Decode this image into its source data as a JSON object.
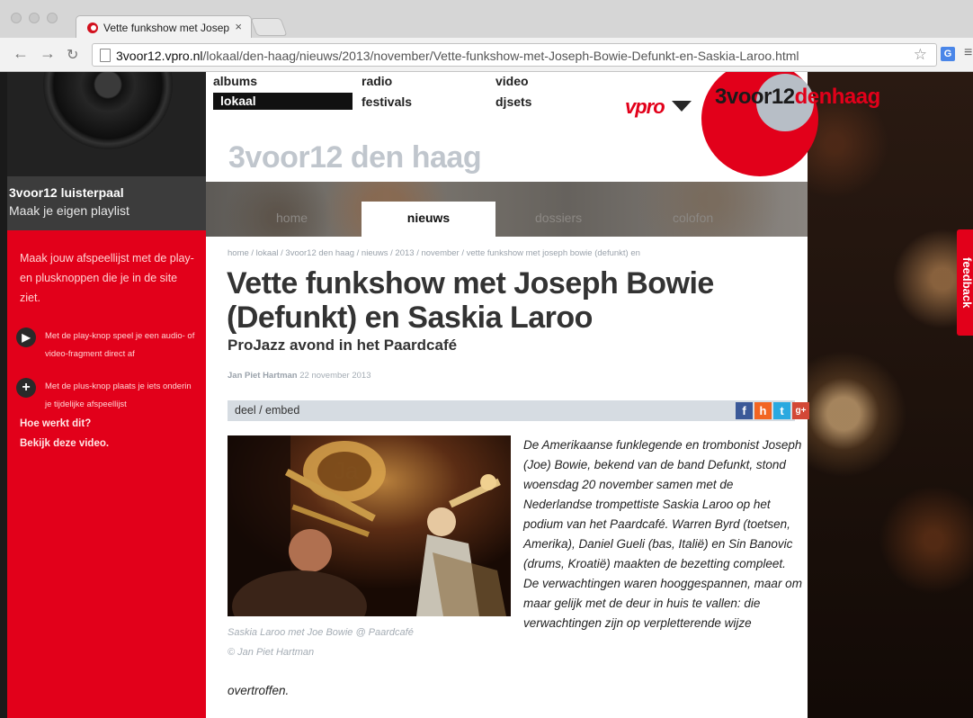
{
  "browser": {
    "tab_title": "Vette funkshow met Joseph",
    "tab_close": "×",
    "url_host": "3voor12.vpro.nl",
    "url_path": "/lokaal/den-haag/nieuws/2013/november/Vette-funkshow-met-Joseph-Bowie-Defunkt-en-Saskia-Laroo.html",
    "icons": [
      "back-icon",
      "forward-icon",
      "reload-icon",
      "star-icon",
      "translate-icon",
      "menu-icon"
    ]
  },
  "topnav": {
    "albums": "albums",
    "lokaal": "lokaal",
    "radio": "radio",
    "festivals": "festivals",
    "video": "video",
    "djsets": "djsets"
  },
  "logo": {
    "vpro": "vpro",
    "brand": "3voor12",
    "city": "denhaag"
  },
  "site_title": "3voor12 den haag",
  "subnav": {
    "home": "home",
    "nieuws": "nieuws",
    "dossiers": "dossiers",
    "colofon": "colofon"
  },
  "sidebar": {
    "title": "3voor12 luisterpaal",
    "subtitle": "Maak je eigen playlist",
    "intro": "Maak jouw afspeellijst met de play- en plusknoppen die je in de site ziet.",
    "play_text": "Met de play-knop speel je een audio- of video-fragment direct af",
    "plus_text": "Met de plus-knop plaats je iets onderin je tijdelijke afspeellijst",
    "how_link": "Hoe werkt dit?",
    "video_link": "Bekijk deze video."
  },
  "feedback": "feedback",
  "breadcrumb": "home /  lokaal /  3voor12 den haag /  nieuws /  2013 /  november /  vette funkshow met joseph bowie (defunkt) en",
  "article": {
    "headline": "Vette funkshow met Joseph Bowie (Defunkt) en Saskia Laroo",
    "subhead": "ProJazz avond in het Paardcafé",
    "author": "Jan Piet Hartman",
    "date": "22 november 2013",
    "share_label": "deel / embed",
    "caption_1": "Saskia Laroo met Joe Bowie @ Paardcafé",
    "caption_2": "© Jan Piet Hartman",
    "lead": "De Amerikaanse funklegende en trombonist Joseph (Joe) Bowie, bekend van de band Defunkt, stond woensdag 20 november samen met de Nederlandse trompettiste Saskia Laroo op het podium van het Paardcafé. Warren Byrd (toetsen, Amerika), Daniel Gueli (bas, Italië) en Sin Banovic (drums, Kroatië) maakten de bezetting compleet. De verwachtingen waren hooggespannen, maar om maar gelijk met de deur in huis te vallen: die verwachtingen zijn op verpletterende wijze",
    "lead_tail": "overtroffen."
  },
  "share_icons": {
    "facebook": "f",
    "hyves": "h",
    "twitter": "t",
    "googleplus": "g+"
  },
  "colors": {
    "brand_red": "#e2001a",
    "facebook": "#3b5998",
    "hyves": "#f26522",
    "twitter": "#2aa9e0",
    "googleplus": "#d34836"
  }
}
